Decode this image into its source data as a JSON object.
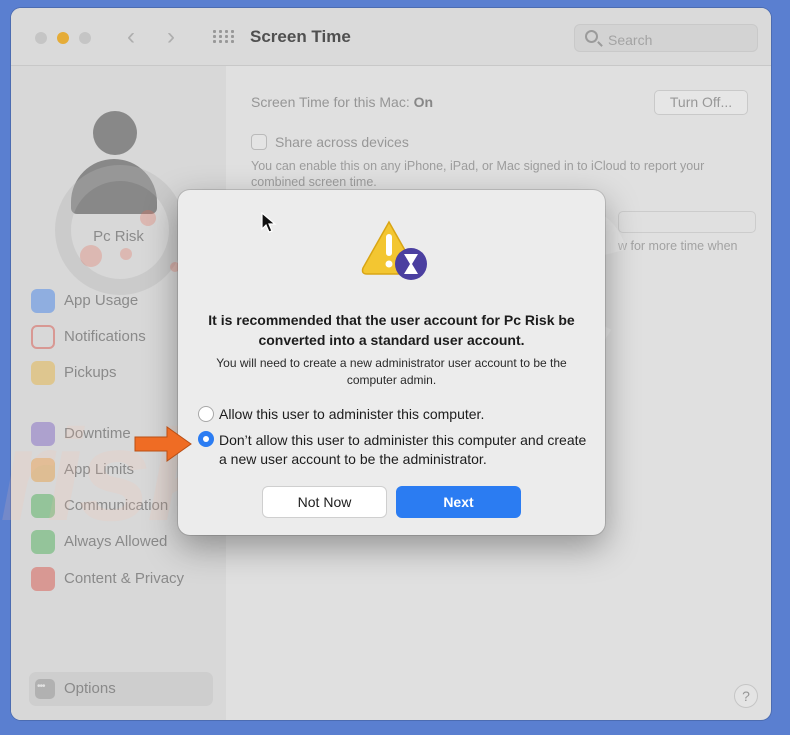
{
  "window": {
    "title": "Screen Time",
    "search_placeholder": "Search"
  },
  "sidebar": {
    "user_name": "Pc Risk",
    "items": [
      {
        "label": "App Usage",
        "color": "#2e7cf6"
      },
      {
        "label": "Notifications",
        "color": "#e4453a"
      },
      {
        "label": "Pickups",
        "color": "#f1b92f"
      },
      {
        "label": "Downtime",
        "color": "#7a5ccc"
      },
      {
        "label": "App Limits",
        "color": "#f2a13a"
      },
      {
        "label": "Communication",
        "color": "#3bb24b"
      },
      {
        "label": "Always Allowed",
        "color": "#3bb24b"
      },
      {
        "label": "Content & Privacy",
        "color": "#e4453a"
      }
    ],
    "options_label": "Options"
  },
  "main": {
    "status_label": "Screen Time for this Mac:",
    "status_value": "On",
    "turn_off_label": "Turn Off...",
    "share_label": "Share across devices",
    "description": "You can enable this on any iPhone, iPad, or Mac signed in to iCloud to report your combined screen time.",
    "faded_text": "w for more time when",
    "help_label": "?"
  },
  "watermark": {
    "top": "PC",
    "bottom": "risk.com"
  },
  "dialog": {
    "title": "It is recommended that the user account for Pc Risk be converted into a standard user account.",
    "body": "You will need to create a new administrator user account to be the computer admin.",
    "options": [
      {
        "label": "Allow this user to administer this computer.",
        "selected": false
      },
      {
        "label": "Don’t allow this user to administer this computer and create a new user account to be the administrator.",
        "selected": true
      }
    ],
    "not_now_label": "Not Now",
    "next_label": "Next",
    "accent_color": "#2b7cf2"
  },
  "annotation": {
    "arrow_color": "#ef6c24"
  }
}
